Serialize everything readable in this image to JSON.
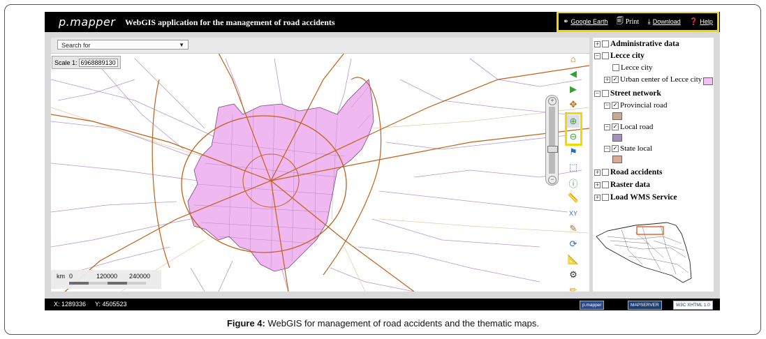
{
  "header": {
    "logo": "p.mapper",
    "title": "WebGIS application for the management of road accidents",
    "links": [
      {
        "icon": "globe-icon",
        "label": "Google Earth"
      },
      {
        "icon": "printer-icon",
        "label": "Print"
      },
      {
        "icon": "download-icon",
        "label": "Download"
      },
      {
        "icon": "help-icon",
        "label": "Help"
      }
    ]
  },
  "map": {
    "search_placeholder": "Search for",
    "scale_label": "Scale 1:",
    "scale_value": "6968889130",
    "scalebar": {
      "unit": "km",
      "ticks": [
        "0",
        "120000",
        "240000"
      ]
    }
  },
  "toc": {
    "groups": [
      {
        "label": "Administrative data"
      },
      {
        "label": "Lecce city"
      },
      {
        "label": "Street network"
      },
      {
        "label": "Road accidents"
      },
      {
        "label": "Raster data"
      },
      {
        "label": "Load WMS Service"
      }
    ],
    "layers": [
      {
        "label": "Lecce city",
        "checked": false
      },
      {
        "label": "Urban center of Lecce city",
        "checked": true,
        "color": "#f3c1f3"
      },
      {
        "label": "Provincial road",
        "checked": true,
        "color": "#c8a993"
      },
      {
        "label": "Local road",
        "checked": true,
        "color": "#a58fbd"
      },
      {
        "label": "State local",
        "checked": true,
        "color": "#d9aa95"
      }
    ]
  },
  "status": {
    "x": "X: 1289336",
    "y": "Y: 4505523",
    "badges": [
      "p.mapper",
      "MAPSERVER",
      "W3C XHTML 1.0"
    ]
  },
  "caption": {
    "bold": "Figure 4:",
    "text": " WebGIS for management of road accidents and the thematic maps."
  },
  "colors": {
    "highlight": "#f5d800",
    "urban": "#f0b8f0",
    "road": "#c0601a",
    "local_road": "#a070c8"
  }
}
